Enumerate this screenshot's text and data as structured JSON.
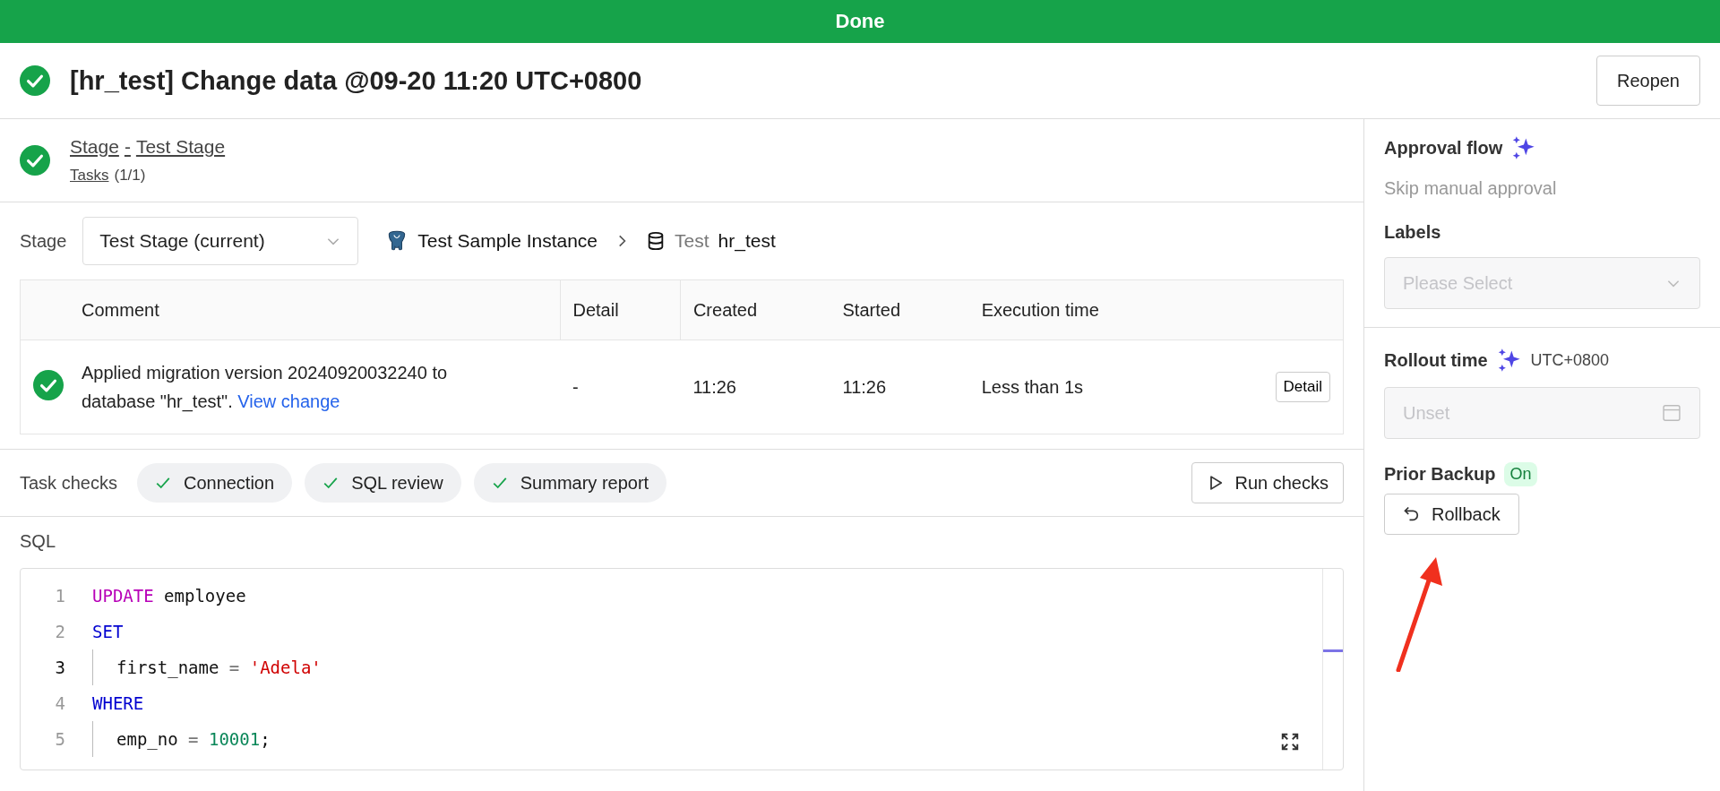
{
  "status_banner": {
    "text": "Done"
  },
  "header": {
    "done": true,
    "title": "[hr_test] Change data @09-20 11:20 UTC+0800",
    "reopen_button": "Reopen"
  },
  "stage_header": {
    "done": true,
    "stage_link": "Stage",
    "separator": "-",
    "stage_name": "Test Stage",
    "tasks_link": "Tasks",
    "tasks_count": "(1/1)"
  },
  "stage_selector": {
    "label": "Stage",
    "value": "Test Stage (current)",
    "instance": "Test Sample Instance",
    "environment": "Test",
    "database": "hr_test"
  },
  "table": {
    "columns": [
      "Comment",
      "Detail",
      "Created",
      "Started",
      "Execution time"
    ],
    "rows": [
      {
        "done": true,
        "comment": "Applied migration version 20240920032240 to database \"hr_test\".",
        "link": "View change",
        "detail": "-",
        "created": "11:26",
        "started": "11:26",
        "execution_time": "Less than 1s",
        "button": "Detail"
      }
    ]
  },
  "task_checks": {
    "label": "Task checks",
    "checks": [
      {
        "label": "Connection",
        "passed": true
      },
      {
        "label": "SQL review",
        "passed": true
      },
      {
        "label": "Summary report",
        "passed": true
      }
    ],
    "run_button": "Run checks"
  },
  "sql": {
    "label": "SQL",
    "lines": [
      {
        "number": "1",
        "current": false,
        "indented": false,
        "tokens": [
          {
            "kind": "keyword2",
            "text": "UPDATE"
          },
          {
            "kind": "plain",
            "text": " employee"
          }
        ]
      },
      {
        "number": "2",
        "current": false,
        "indented": false,
        "tokens": [
          {
            "kind": "keyword",
            "text": "SET"
          }
        ]
      },
      {
        "number": "3",
        "current": true,
        "indented": true,
        "tokens": [
          {
            "kind": "plain",
            "text": "first_name "
          },
          {
            "kind": "operator",
            "text": "= "
          },
          {
            "kind": "string",
            "text": "'Adela'"
          }
        ]
      },
      {
        "number": "4",
        "current": false,
        "indented": false,
        "tokens": [
          {
            "kind": "keyword",
            "text": "WHERE"
          }
        ]
      },
      {
        "number": "5",
        "current": false,
        "indented": true,
        "tokens": [
          {
            "kind": "plain",
            "text": "emp_no "
          },
          {
            "kind": "operator",
            "text": "= "
          },
          {
            "kind": "number",
            "text": "10001"
          },
          {
            "kind": "plain",
            "text": ";"
          }
        ]
      }
    ]
  },
  "sidebar": {
    "approval_flow": {
      "label": "Approval flow",
      "value": "Skip manual approval"
    },
    "labels": {
      "label": "Labels",
      "placeholder": "Please Select"
    },
    "rollout_time": {
      "label": "Rollout time",
      "timezone": "UTC+0800",
      "placeholder": "Unset"
    },
    "prior_backup": {
      "label": "Prior Backup",
      "on": true,
      "state_text": "On",
      "rollback_button": "Rollback"
    }
  }
}
